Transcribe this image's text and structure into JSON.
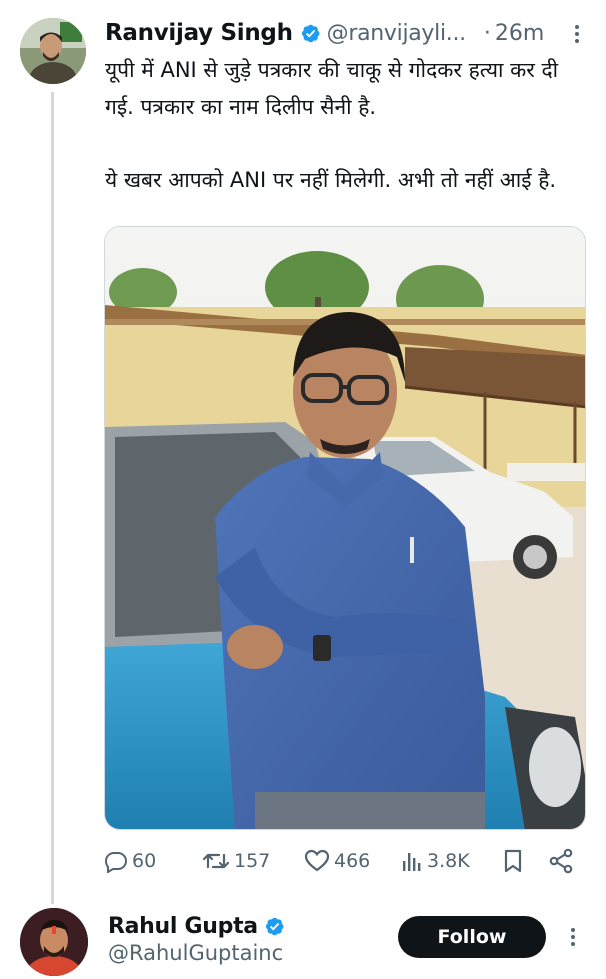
{
  "tweet": {
    "author_name": "Ranvijay Singh",
    "author_handle": "@ranvijayli...",
    "separator": "·",
    "timestamp": "26m",
    "text_line_1": "यूपी में ANI से जुड़े पत्रकार की चाकू से गोदकर हत्या कर दी गई. पत्रकार का नाम दिलीप सैनी है.",
    "text_line_2": "ये खबर आपको ANI पर नहीं मिलेगी. अभी तो नहीं आई है.",
    "metrics": {
      "replies": "60",
      "retweets": "157",
      "likes": "466",
      "views": "3.8K"
    }
  },
  "reply": {
    "author_name": "Rahul Gupta",
    "author_handle": "@RahulGuptainc",
    "follow_label": "Follow"
  },
  "icons": {
    "verified": "verified-badge-icon",
    "reply": "reply-bubble-icon",
    "retweet": "retweet-icon",
    "like": "heart-icon",
    "views": "bar-chart-icon",
    "bookmark": "bookmark-icon",
    "share": "share-icon",
    "more": "more-vertical-icon"
  },
  "colors": {
    "text_primary": "#0f1419",
    "text_secondary": "#536471",
    "verified_blue": "#1d9bf0",
    "follow_button": "#0f1419",
    "thread_line": "#cfd9de"
  }
}
